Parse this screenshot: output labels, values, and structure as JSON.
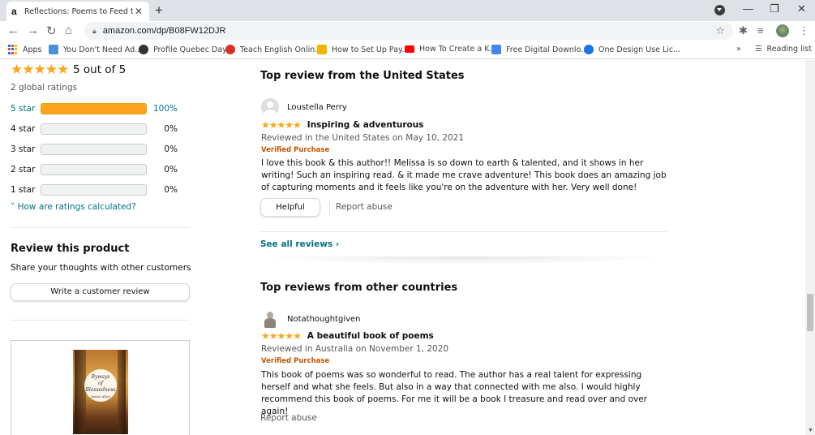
{
  "browser": {
    "tab_title": "Reflections: Poems to Feed the S",
    "tab_favicon": "a",
    "url": "amazon.com/dp/B08FW12DJR",
    "bookmarks": [
      {
        "label": "Apps",
        "icon": "apps-grid-icon"
      },
      {
        "label": "You Don't Need Ad...",
        "icon": "bookmark-favicon",
        "color": "#4a90d9"
      },
      {
        "label": "Profile Quebec Days",
        "icon": "globe-icon",
        "color": "#333333"
      },
      {
        "label": "Teach English Onlin...",
        "icon": "bookmark-favicon",
        "color": "#d93025"
      },
      {
        "label": "How to Set Up Pay...",
        "icon": "bookmark-favicon",
        "color": "#f4b400"
      },
      {
        "label": "How To Create a K...",
        "icon": "youtube-icon",
        "color": "#ff0000"
      },
      {
        "label": "Free Digital Downlo...",
        "icon": "bookmark-favicon",
        "color": "#4285f4"
      },
      {
        "label": "One Design Use Lic...",
        "icon": "bookmark-favicon",
        "color": "#1a73e8"
      }
    ],
    "reading_list": "Reading list",
    "overflow": "»"
  },
  "ratings": {
    "stars": "★★★★★",
    "summary": "5 out of 5",
    "global": "2 global ratings",
    "histogram": [
      {
        "label": "5 star",
        "pct": "100%",
        "value": 100
      },
      {
        "label": "4 star",
        "pct": "0%",
        "value": 0
      },
      {
        "label": "3 star",
        "pct": "0%",
        "value": 0
      },
      {
        "label": "2 star",
        "pct": "0%",
        "value": 0
      },
      {
        "label": "1 star",
        "pct": "0%",
        "value": 0
      }
    ],
    "how_calculated": "How are ratings calculated?"
  },
  "review_product": {
    "title": "Review this product",
    "subtitle": "Share your thoughts with other customers",
    "button": "Write a customer review"
  },
  "ad": {
    "cover_title_1": "Byways",
    "cover_title_2": "of",
    "cover_title_3": "Blessedness",
    "cover_author": "James Allen"
  },
  "us_section": {
    "title": "Top review from the United States",
    "review": {
      "author": "Loustella Perry",
      "stars": "★★★★★",
      "headline": "Inspiring & adventurous",
      "meta": "Reviewed in the United States on May 10, 2021",
      "verified": "Verified Purchase",
      "body": "I love this book & this author!! Melissa is so down to earth & talented, and it shows in her writing! Such an inspiring read. & it made me crave adventure! This book does an amazing job of capturing moments and it feels like you're on the adventure with her. Very well done!",
      "helpful": "Helpful",
      "report": "Report abuse"
    },
    "see_all": "See all reviews ›"
  },
  "other_section": {
    "title": "Top reviews from other countries",
    "review": {
      "author": "Notathoughtgiven",
      "stars": "★★★★★",
      "headline": "A beautiful book of poems",
      "meta": "Reviewed in Australia on November 1, 2020",
      "verified": "Verified Purchase",
      "body": "This book of poems was so wonderful to read. The author has a real talent for expressing herself and what she feels. But also in a way that connected with me also. I would highly recommend this book of poems. For me it will be a book I treasure and read over and over again!",
      "report": "Report abuse"
    }
  },
  "colors": {
    "star": "#ffa41c",
    "link": "#007185",
    "verified": "#c45500"
  }
}
